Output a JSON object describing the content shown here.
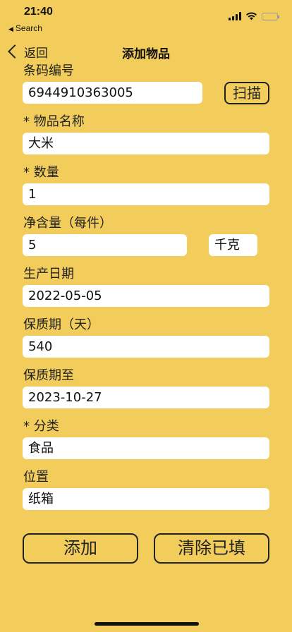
{
  "status_bar": {
    "time": "21:40",
    "back_app": "Search"
  },
  "nav": {
    "back_label": "返回",
    "title": "添加物品"
  },
  "form": {
    "barcode": {
      "label": "条码编号",
      "value": "6944910363005",
      "scan_label": "扫描"
    },
    "name": {
      "label": "* 物品名称",
      "value": "大米"
    },
    "quantity": {
      "label": "* 数量",
      "value": "1"
    },
    "net_content": {
      "label": "净含量（每件）",
      "value": "5",
      "unit": "千克"
    },
    "production_date": {
      "label": "生产日期",
      "value": "2022-05-05"
    },
    "shelf_life": {
      "label": "保质期（天）",
      "value": "540"
    },
    "expiry": {
      "label": "保质期至",
      "value": "2023-10-27"
    },
    "category": {
      "label": "* 分类",
      "value": "食品"
    },
    "location": {
      "label": "位置",
      "value": "纸箱"
    }
  },
  "actions": {
    "add_label": "添加",
    "clear_label": "清除已填"
  },
  "colors": {
    "background": "#F2CD5C",
    "input_bg": "#FFFFFF",
    "outline": "#222222"
  }
}
